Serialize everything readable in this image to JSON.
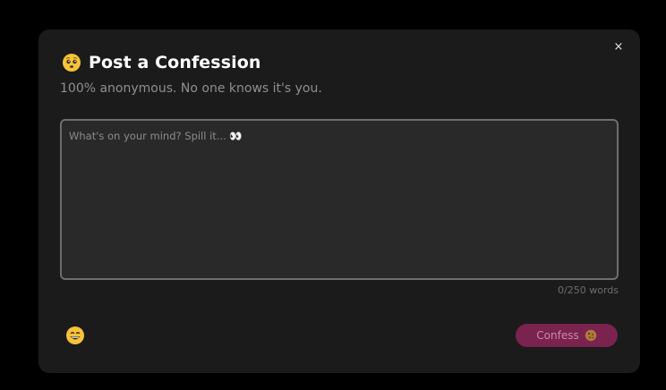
{
  "dialog": {
    "title": "Post a Confession",
    "subtitle": "100% anonymous. No one knows it's you.",
    "close_label": "×",
    "title_icon": "pleading-face-icon"
  },
  "composer": {
    "placeholder": "What's on your mind? Spill it... 👀",
    "value": "",
    "word_count": "0/250 words"
  },
  "footer": {
    "emoji_icon": "grinning-face-icon",
    "confess_label": "Confess",
    "confess_icon": "cookie-icon"
  },
  "colors": {
    "background": "#000000",
    "modal": "#1b1b1b",
    "input_bg": "#292929",
    "input_border": "#6e6e6e",
    "confess_button": "#7a234f",
    "confess_text": "#c98aa8"
  }
}
